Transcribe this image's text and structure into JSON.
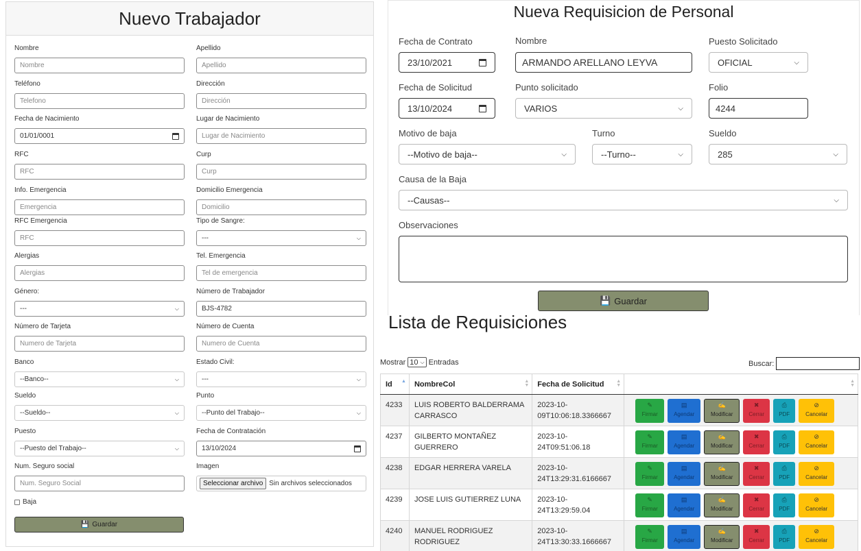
{
  "left_form": {
    "title": "Nuevo Trabajador",
    "fields": [
      {
        "label": "Nombre",
        "placeholder": "Nombre"
      },
      {
        "label": "Apellido",
        "placeholder": "Apellido"
      },
      {
        "label": "Teléfono",
        "placeholder": "Telefono"
      },
      {
        "label": "Dirección",
        "placeholder": "Dirección"
      },
      {
        "label": "Fecha de Nacimiento",
        "value": "01/01/0001"
      },
      {
        "label": "Lugar de Nacimiento",
        "placeholder": "Lugar de Nacimiento"
      },
      {
        "label": "RFC",
        "placeholder": "RFC"
      },
      {
        "label": "Curp",
        "placeholder": "Curp"
      },
      {
        "label": "Info. Emergencia",
        "placeholder": "Emergencia"
      },
      {
        "label": "Domicilio Emergencia",
        "placeholder": "Domicilio"
      },
      {
        "label": "RFC Emergencia",
        "placeholder": "RFC"
      },
      {
        "label": "Tipo de Sangre:",
        "value": "---"
      },
      {
        "label": "Alergias",
        "placeholder": "Alergias"
      },
      {
        "label": "Tel. Emergencia",
        "placeholder": "Tel de emergencia"
      },
      {
        "label": "Género:",
        "value": "---"
      },
      {
        "label": "Número de Trabajador",
        "value": "BJS-4782"
      },
      {
        "label": "Número de Tarjeta",
        "placeholder": "Numero de Tarjeta"
      },
      {
        "label": "Número de Cuenta",
        "placeholder": "Numero de Cuenta"
      },
      {
        "label": "Banco",
        "value": "--Banco--"
      },
      {
        "label": "Estado Civil:",
        "value": "---"
      },
      {
        "label": "Sueldo",
        "value": "--Sueldo--"
      },
      {
        "label": "Punto",
        "value": "--Punto del Trabajo--"
      },
      {
        "label": "Puesto",
        "value": "--Puesto del Trabajo--"
      },
      {
        "label": "Fecha de Contratación",
        "value": "13/10/2024"
      },
      {
        "label": "Num. Seguro social",
        "placeholder": "Num. Seguro Social"
      },
      {
        "label": "Imagen",
        "file_button": "Seleccionar archivo",
        "file_text": "Sin archivos seleccionados"
      }
    ],
    "baja_label": "Baja",
    "save_label": "Guardar"
  },
  "right_form": {
    "title": "Nueva Requisicion de Personal",
    "fecha_contrato": {
      "label": "Fecha de Contrato",
      "value": "23/10/2021"
    },
    "nombre": {
      "label": "Nombre",
      "value": "ARMANDO ARELLANO LEYVA"
    },
    "puesto": {
      "label": "Puesto Solicitado",
      "value": "OFICIAL"
    },
    "fecha_solicitud": {
      "label": "Fecha de Solicitud",
      "value": "13/10/2024"
    },
    "punto": {
      "label": "Punto solicitado",
      "value": "VARIOS"
    },
    "folio": {
      "label": "Folio",
      "value": "4244"
    },
    "motivo": {
      "label": "Motivo de baja",
      "value": "--Motivo de baja--"
    },
    "turno": {
      "label": "Turno",
      "value": "--Turno--"
    },
    "sueldo": {
      "label": "Sueldo",
      "value": "285"
    },
    "causa": {
      "label": "Causa de la Baja",
      "value": "--Causas--"
    },
    "observaciones": {
      "label": "Observaciones"
    },
    "save_label": "Guardar"
  },
  "list": {
    "title": "Lista de Requisiciones",
    "show_label": "Mostrar",
    "page_length": "10",
    "entries_label": "Entradas",
    "search_label": "Buscar:",
    "columns": [
      "Id",
      "NombreCol",
      "Fecha de Solicitud",
      ""
    ],
    "rows": [
      {
        "id": "4233",
        "name": "LUIS ROBERTO BALDERRAMA CARRASCO",
        "date": "2023-10-09T10:06:18.3366667"
      },
      {
        "id": "4237",
        "name": "GILBERTO MONTAÑEZ GUERRERO",
        "date": "2023-10-24T09:51:06.18"
      },
      {
        "id": "4238",
        "name": "EDGAR HERRERA VARELA",
        "date": "2023-10-24T13:29:31.6166667"
      },
      {
        "id": "4239",
        "name": "JOSE LUIS GUTIERREZ LUNA",
        "date": "2023-10-24T13:29:59.04"
      },
      {
        "id": "4240",
        "name": "MANUEL RODRIGUEZ RODRIGUEZ",
        "date": "2023-10-24T13:30:33.1666667"
      }
    ],
    "actions": {
      "firmar": "Firmar",
      "agendar": "Agendar",
      "modificar": "Modificar",
      "cerrar": "Cerrar",
      "pdf": "PDF",
      "cancelar": "Cancelar"
    }
  },
  "colors": {
    "save_button": "#858e6e",
    "firmar": "#28a745",
    "agendar": "#1f6fd1",
    "cerrar": "#dc3545",
    "pdf": "#17a2b8",
    "cancelar": "#ffc107"
  }
}
